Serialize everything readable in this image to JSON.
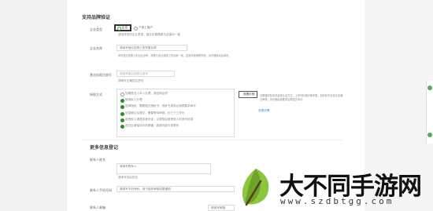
{
  "section1": {
    "title": "支持品牌验证",
    "rows": [
      {
        "label": "企业类型",
        "option_selected": "企业",
        "option_other": "个体工商户",
        "hint": "请选择您的企业类型，营业执照需要与此保持一致"
      },
      {
        "label": "企业名称",
        "value": "请填写营业执照上的完整名称",
        "hint": "填写营业执照上的企业全称，需要与营业执照上的名称一致，否则可能审核失败，请仔细核对后填写。"
      },
      {
        "label": "营业执照注册号",
        "value": "请填写营业执照注册号",
        "hint": "请填写正确的注册号"
      },
      {
        "label": "授权方式",
        "options": [
          "如果是法人本人办理，请选择此项",
          "被授权人办理",
          "选择授权，需要提交授权书，授权书请务必按照要求填写",
          "信息确认后提交，需要等待审核，约三个工作日",
          "被授权人请提供身份证，以便核实被授权人的身份信息",
          "提交后请保持手机畅通，客服可能与您联系"
        ]
      }
    ],
    "tip_button": "查看示例",
    "tip_text": "请根据实际情况选择认证方式，上传材料需清晰完整，如材料不全将无法通过审核，请仔细阅读要求后再提交申请。",
    "tip_link": "查看详情"
  },
  "section2": {
    "title": "更多信息登记",
    "rows": [
      {
        "label": "联系人姓名",
        "value": "请填写联系人",
        "hint": "请填写真实姓名"
      },
      {
        "label": "联系人手机号码",
        "value": "请填写手机号码，用于接收审核结果通知"
      },
      {
        "label": "联系人邮箱",
        "value": "请填写邮箱"
      }
    ]
  },
  "watermark": {
    "brand": "大不同手游网",
    "url": "www.szdbtgg.com"
  },
  "colors": {
    "accent_green": "#2a8c2a",
    "link_blue": "#3a8fd6"
  }
}
